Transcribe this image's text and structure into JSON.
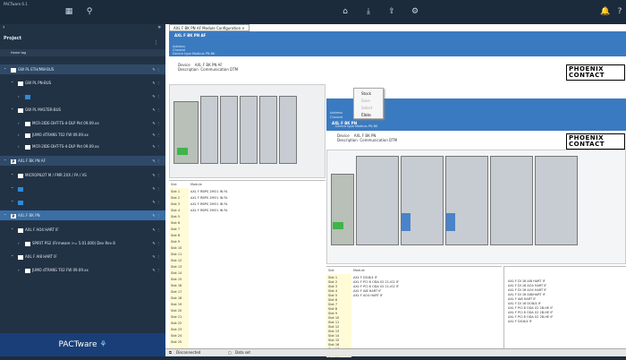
{
  "app": {
    "title": "PACTware 6.1",
    "brand": "PACTware",
    "colors": {
      "accent": "#3a7ac0",
      "sidebar": "#223245",
      "selection": "#3a6ea5"
    }
  },
  "toolbar": {
    "left_icons": [
      "grid-icon",
      "search-icon"
    ],
    "right_icons": [
      "home-icon",
      "download-icon",
      "export-icon",
      "settings-icon"
    ],
    "corner_icons": [
      "notification-icon",
      "help-icon"
    ]
  },
  "sidebar": {
    "project_label": "Project",
    "root_label": "Home tag",
    "items": [
      {
        "label": "GW PL ETH/MW-BUS",
        "indent": 0,
        "badge": "",
        "hl": "hl"
      },
      {
        "label": "GW PL PN-BUS",
        "indent": 1,
        "badge": "",
        "hl": ""
      },
      {
        "label": "",
        "indent": 2,
        "badge": "blue",
        "hl": ""
      },
      {
        "label": "GW PL MASTER-BUS",
        "indent": 1,
        "badge": "",
        "hl": ""
      },
      {
        "label": "MCR-2IDE-DHT-TS-4-DLP Pkt 09.09.xx",
        "indent": 2,
        "badge": "",
        "hl": ""
      },
      {
        "label": "JUMO dTRANS T02 FW 09.09.xx",
        "indent": 2,
        "badge": "",
        "hl": ""
      },
      {
        "label": "MCR-2IDE-DHT-TS-4-DLP Pkt 09.09.xx",
        "indent": 2,
        "badge": "",
        "hl": ""
      },
      {
        "label": "AXL F BK PN AF",
        "indent": 0,
        "badge": "P",
        "hl": "hl"
      },
      {
        "label": "MICROPILOT M / FMR 2XX / FA / VS",
        "indent": 1,
        "badge": "",
        "hl": ""
      },
      {
        "label": "",
        "indent": 1,
        "badge": "blue",
        "hl": ""
      },
      {
        "label": "",
        "indent": 1,
        "badge": "blue",
        "hl": ""
      },
      {
        "label": "AXL F BK PN",
        "indent": 0,
        "badge": "P",
        "hl": "sel"
      },
      {
        "label": "AXL F AO4 HART IF",
        "indent": 1,
        "badge": "",
        "hl": ""
      },
      {
        "label": "SPIRIT PS2 (Firmware >= 5.01.000) Dev Rev 8",
        "indent": 2,
        "badge": "",
        "hl": ""
      },
      {
        "label": "AXL F AI8 HART IF",
        "indent": 1,
        "badge": "",
        "hl": ""
      },
      {
        "label": "JUMO dTRANS T02 FW 09.09.xx",
        "indent": 2,
        "badge": "",
        "hl": ""
      }
    ]
  },
  "tab": {
    "label": "AXL F BK PN AF Module Configuration"
  },
  "win1": {
    "title": "AXL F BK PN AF",
    "f1": "Address",
    "f2": "Channel",
    "f3": "Device type   Modbus PN BK",
    "device_label": "Device",
    "device_value": "AXL F BK PN AF",
    "desc_label": "Description",
    "desc_value": "Communication DTM",
    "logo1": "PHOENIX",
    "logo2": "CONTACT",
    "col_slot": "Slot",
    "col_module": "Module",
    "slots": [
      "Slot 1",
      "Slot 2",
      "Slot 3",
      "Slot 4",
      "Slot 5",
      "Slot 6",
      "Slot 7",
      "Slot 8",
      "Slot 9",
      "Slot 10",
      "Slot 11",
      "Slot 12",
      "Slot 13",
      "Slot 14",
      "Slot 15",
      "Slot 16",
      "Slot 17",
      "Slot 18",
      "Slot 19",
      "Slot 20",
      "Slot 21",
      "Slot 22",
      "Slot 23",
      "Slot 24",
      "Slot 25"
    ],
    "modules": [
      "AXL F RBPS 2MO1 IN FA",
      "AXL F RBPS 2MO1 IN FA",
      "AXL F RBPS 2MO1 IN FA",
      "AXL F RBPS 2MO1 IN FA"
    ]
  },
  "context_menu": {
    "items": [
      "Stock",
      "Save",
      "Select Item",
      "Close"
    ],
    "disabled": [
      false,
      true,
      true,
      false
    ]
  },
  "win2": {
    "title": "AXL F BK PN",
    "f1": "Address",
    "f2": "Channel",
    "f3": "Device type   Modbus PN BK",
    "device_label": "Device",
    "device_value": "AXL F BK PN",
    "desc_label": "Description",
    "desc_value": "Communication DTM",
    "logo1": "PHOENIX",
    "logo2": "CONTACT",
    "col_slot": "Slot",
    "col_module": "Module",
    "slots": [
      "Slot 1",
      "Slot 2",
      "Slot 3",
      "Slot 4",
      "Slot 5",
      "Slot 6",
      "Slot 7",
      "Slot 8",
      "Slot 9",
      "Slot 10",
      "Slot 11",
      "Slot 12",
      "Slot 13",
      "Slot 14",
      "Slot 15",
      "Slot 16",
      "Slot 17",
      "Slot 18",
      "Slot 19"
    ],
    "modules": [
      "AXL F DI16/4 IF",
      "AXL F PCI 8 ODA 02 21-I02 IF",
      "AXL F PCI 8 ODA 02 21-I02 IF",
      "AXL F AI8 HART IF",
      "AXL F AO4 HART IF"
    ],
    "catalog": [
      "AXL F DI 16 AI8 HART IF",
      "AXL F DI 16 AO4 HART IF",
      "AXL F DI 16 AO4 HART IF",
      "AXL F DI 16 AI8/HART IF",
      "AXL F AI8 HART IF",
      "AXL F DI 16 DO8/4 IF",
      "AXL F PCI 8 ODA 02 2B-HE IF",
      "AXL F PCI 8 ODA 02 2B-HE IF",
      "AXL F PCI 8 ODA 02 2B-HE IF",
      "AXL F DI16/4 IF"
    ]
  },
  "status": {
    "connection": "Disconnected",
    "dataset": "Data set"
  }
}
